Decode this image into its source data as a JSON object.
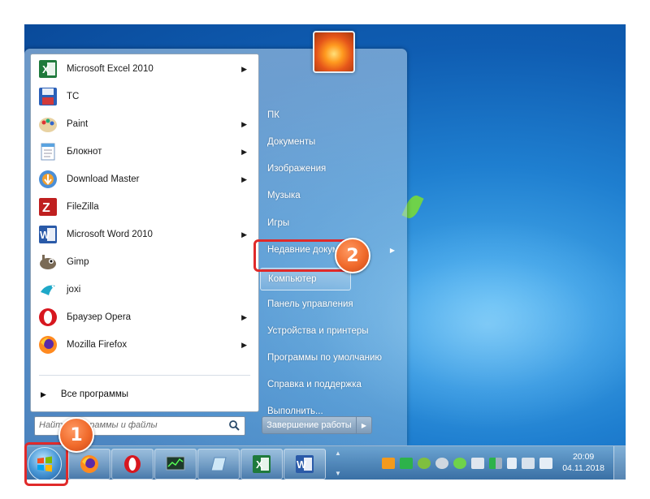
{
  "programs": [
    {
      "label": "Microsoft Excel 2010",
      "icon": "excel-icon",
      "submenu": true
    },
    {
      "label": "TC",
      "icon": "total-commander-icon",
      "submenu": false
    },
    {
      "label": "Paint",
      "icon": "paint-icon",
      "submenu": true
    },
    {
      "label": "Блокнот",
      "icon": "notepad-icon",
      "submenu": true
    },
    {
      "label": "Download Master",
      "icon": "download-master-icon",
      "submenu": true
    },
    {
      "label": "FileZilla",
      "icon": "filezilla-icon",
      "submenu": false
    },
    {
      "label": "Microsoft Word 2010",
      "icon": "word-icon",
      "submenu": true
    },
    {
      "label": "Gimp",
      "icon": "gimp-icon",
      "submenu": false
    },
    {
      "label": "joxi",
      "icon": "joxi-icon",
      "submenu": false
    },
    {
      "label": "Браузер Opera",
      "icon": "opera-icon",
      "submenu": true
    },
    {
      "label": "Mozilla Firefox",
      "icon": "firefox-icon",
      "submenu": true
    }
  ],
  "all_programs_label": "Все программы",
  "search_placeholder": "Найти программы и файлы",
  "right_items": [
    {
      "label": "ПК",
      "submenu": false
    },
    {
      "label": "Документы",
      "submenu": false
    },
    {
      "label": "Изображения",
      "submenu": false
    },
    {
      "label": "Музыка",
      "submenu": false
    },
    {
      "label": "Игры",
      "submenu": false
    },
    {
      "label": "Недавние документы",
      "submenu": true
    },
    {
      "label": "Компьютер",
      "submenu": false,
      "highlighted": true
    },
    {
      "label": "Панель управления",
      "submenu": false
    },
    {
      "label": "Устройства и принтеры",
      "submenu": false
    },
    {
      "label": "Программы по умолчанию",
      "submenu": false
    },
    {
      "label": "Справка и поддержка",
      "submenu": false
    },
    {
      "label": "Выполнить...",
      "submenu": false
    }
  ],
  "shutdown_label": "Завершение работы",
  "taskbar_items": [
    "start-orb",
    "firefox-icon",
    "opera-icon",
    "task-manager-icon",
    "notepad-icon",
    "excel-icon",
    "word-icon"
  ],
  "clock": {
    "time": "20:09",
    "date": "04.11.2018"
  },
  "annotations": {
    "step1": "1",
    "step2": "2"
  },
  "colors": {
    "annotation": "#e02a2a",
    "badge": "#f06a2b",
    "accent": "#1f7fd0"
  }
}
